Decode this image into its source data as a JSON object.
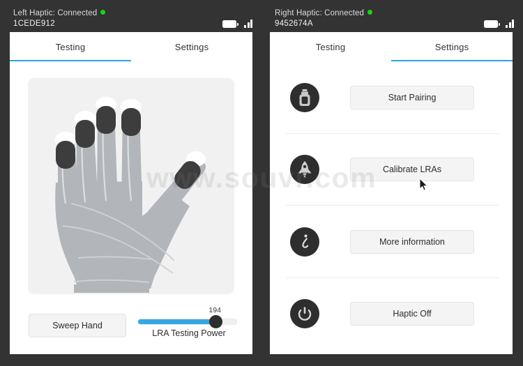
{
  "watermark": "www.souvr.com",
  "theme": {
    "background": "#333333",
    "panel": "#ffffff",
    "accent": "#29a3e0",
    "status_dot": "#12d812",
    "icon_circle": "#2e2e2e",
    "button_fill": "#f4f4f4",
    "slider_fill": "#33a8e0",
    "slider_thumb": "#2e2e2e",
    "glove_box": "#f1f1f1",
    "glove_body": "#b3b6ba",
    "glove_pad": "#3c3c3c",
    "glove_cap": "#ffffff"
  },
  "left_panel": {
    "header": {
      "status_label": "Left Haptic: Connected",
      "device_id": "1CEDE912",
      "battery_icon": "battery-icon",
      "signal_icon": "signal-bars-icon"
    },
    "tabs": [
      {
        "label": "Testing",
        "active": true
      },
      {
        "label": "Settings",
        "active": false
      }
    ],
    "glove": {
      "name": "haptic-glove-illustration",
      "fingertip_count": 5
    },
    "controls": {
      "sweep_button": "Sweep Hand",
      "slider": {
        "label": "LRA Testing Power",
        "value": "194",
        "fill_percent": 77
      }
    }
  },
  "right_panel": {
    "header": {
      "status_label": "Right Haptic: Connected",
      "device_id": "9452674A",
      "battery_icon": "battery-icon",
      "signal_icon": "signal-bars-icon"
    },
    "tabs": [
      {
        "label": "Testing",
        "active": false
      },
      {
        "label": "Settings",
        "active": true
      }
    ],
    "settings_rows": [
      {
        "icon": "usb-drive-icon",
        "button_label": "Start Pairing"
      },
      {
        "icon": "rocket-icon",
        "button_label": "Calibrate LRAs"
      },
      {
        "icon": "info-icon",
        "button_label": "More information"
      },
      {
        "icon": "power-icon",
        "button_label": "Haptic Off"
      }
    ]
  }
}
